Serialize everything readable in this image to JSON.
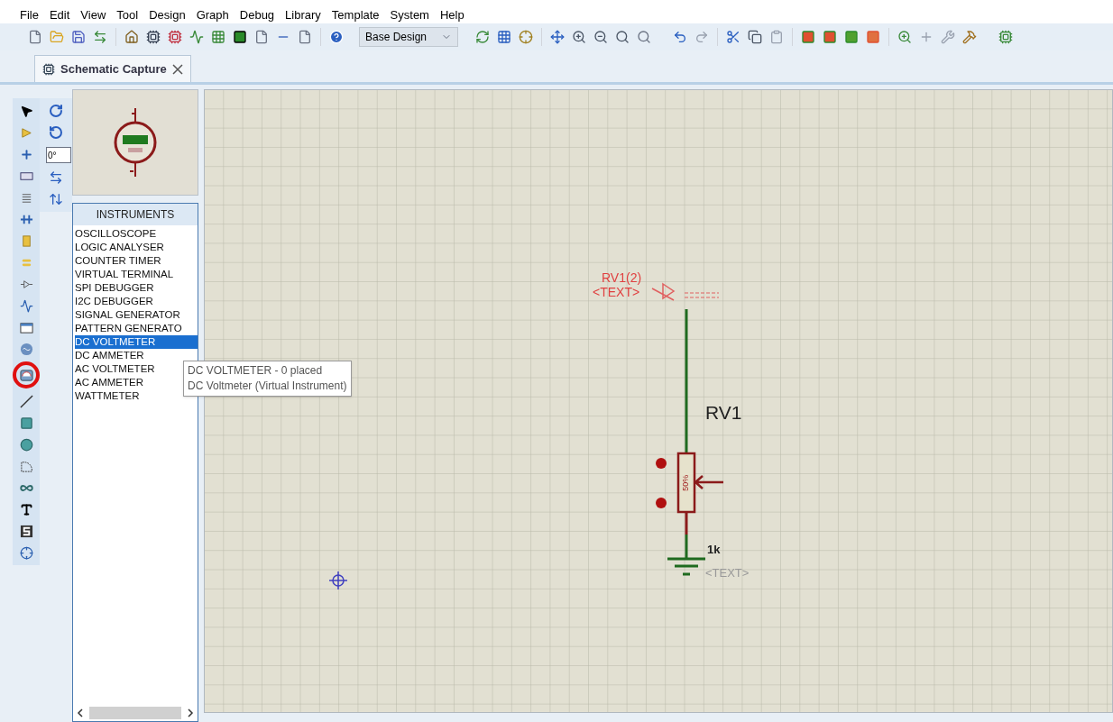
{
  "menu": [
    "File",
    "Edit",
    "View",
    "Tool",
    "Design",
    "Graph",
    "Debug",
    "Library",
    "Template",
    "System",
    "Help"
  ],
  "toolbar": {
    "variant": {
      "value": "Base Design"
    }
  },
  "tab": {
    "label": "Schematic Capture",
    "selected": true
  },
  "mode_tools": [
    {
      "kind": "pointer",
      "circled": false
    },
    {
      "kind": "component",
      "circled": false
    },
    {
      "kind": "junction",
      "circled": false
    },
    {
      "kind": "label",
      "circled": false
    },
    {
      "kind": "script",
      "circled": false
    },
    {
      "kind": "bus",
      "circled": false
    },
    {
      "kind": "subcircuit",
      "circled": false
    },
    {
      "kind": "terminal",
      "circled": false
    },
    {
      "kind": "pin",
      "circled": false
    },
    {
      "kind": "graph",
      "circled": false
    },
    {
      "kind": "tape",
      "circled": false
    },
    {
      "kind": "generator",
      "circled": false
    },
    {
      "kind": "instrument",
      "circled": true
    },
    {
      "kind": "line",
      "circled": false
    },
    {
      "kind": "box",
      "circled": false
    },
    {
      "kind": "circle",
      "circled": false
    },
    {
      "kind": "arc",
      "circled": false
    },
    {
      "kind": "path",
      "circled": false
    },
    {
      "kind": "text",
      "circled": false
    },
    {
      "kind": "symbol",
      "circled": false
    },
    {
      "kind": "marker",
      "circled": false
    }
  ],
  "rotation": {
    "value": "0°"
  },
  "device_panel": {
    "title": "INSTRUMENTS",
    "items": [
      {
        "label": "OSCILLOSCOPE",
        "selected": false
      },
      {
        "label": "LOGIC ANALYSER",
        "selected": false
      },
      {
        "label": "COUNTER TIMER",
        "selected": false
      },
      {
        "label": "VIRTUAL TERMINAL",
        "selected": false
      },
      {
        "label": "SPI DEBUGGER",
        "selected": false
      },
      {
        "label": "I2C DEBUGGER",
        "selected": false
      },
      {
        "label": "SIGNAL GENERATOR",
        "selected": false
      },
      {
        "label": "PATTERN GENERATO",
        "selected": false
      },
      {
        "label": "DC VOLTMETER",
        "selected": true
      },
      {
        "label": "DC AMMETER",
        "selected": false
      },
      {
        "label": "AC VOLTMETER",
        "selected": false
      },
      {
        "label": "AC AMMETER",
        "selected": false
      },
      {
        "label": "WATTMETER",
        "selected": false
      }
    ]
  },
  "tooltip": {
    "title": "DC VOLTMETER - 0 placed",
    "description": "DC Voltmeter (Virtual Instrument)"
  },
  "schematic": {
    "terminal_label": "RV1(2)",
    "terminal_text": "<TEXT>",
    "part_ref": "RV1",
    "wiper_value": "50%",
    "part_value": "1k",
    "part_text": "<TEXT>"
  }
}
